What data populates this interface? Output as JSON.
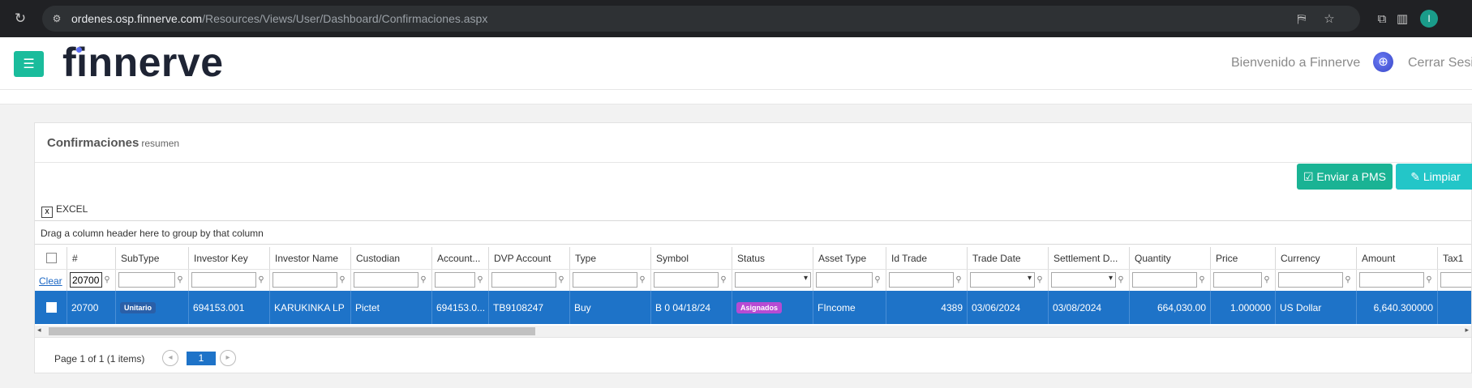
{
  "browser": {
    "url_host": "ordenes.osp.finnerve.com",
    "url_path": "/Resources/Views/User/Dashboard/Confirmaciones.aspx",
    "profile_initial": "I"
  },
  "header": {
    "logo": "finnerve",
    "welcome": "Bienvenido a Finnerve",
    "logout": "Cerrar Sesión"
  },
  "panel": {
    "title": "Confirmaciones",
    "subtitle": "resumen",
    "send_pms_label": "Enviar a PMS",
    "clear_label": "Limpiar",
    "excel_label": "EXCEL",
    "group_hint": "Drag a column header here to group by that column"
  },
  "grid": {
    "columns": [
      "#",
      "SubType",
      "Investor Key",
      "Investor Name",
      "Custodian",
      "Account...",
      "DVP Account",
      "Type",
      "Symbol",
      "Status",
      "Asset Type",
      "Id Trade",
      "Trade Date",
      "Settlement D...",
      "Quantity",
      "Price",
      "Currency",
      "Amount",
      "Tax1"
    ],
    "filter_clear": "Clear",
    "filter_id_value": "20700",
    "row": {
      "id": "20700",
      "subtype": "Unitario",
      "investor_key": "694153.001",
      "investor_name": "KARUKINKA LP",
      "custodian": "Pictet",
      "account": "694153.0...",
      "dvp_account": "TB9108247",
      "type": "Buy",
      "symbol": "B 0 04/18/24",
      "status": "Asignados",
      "asset_type": "FIncome",
      "id_trade": "4389",
      "trade_date": "03/06/2024",
      "settlement_date": "03/08/2024",
      "quantity": "664,030.00",
      "price": "1.000000",
      "currency": "US Dollar",
      "amount": "6,640.300000",
      "tax1": ""
    }
  },
  "pager": {
    "summary": "Page 1 of 1 (1 items)",
    "current_page": "1"
  },
  "colors": {
    "accent_green": "#1ab394",
    "accent_teal": "#23c6c8",
    "selected_row": "#1e73c8",
    "badge_unitario": "#2a5fa8",
    "badge_asignados": "#b64bd3",
    "chrome_bg": "#202124"
  },
  "icons": [
    "reload-icon",
    "site-info-icon",
    "translate-icon",
    "star-icon",
    "extensions-icon",
    "sidepanel-icon",
    "menu-icon",
    "globe-icon",
    "check-square-icon",
    "brush-icon",
    "excel-icon",
    "filter-icon",
    "chevron-left-icon",
    "chevron-right-icon"
  ]
}
